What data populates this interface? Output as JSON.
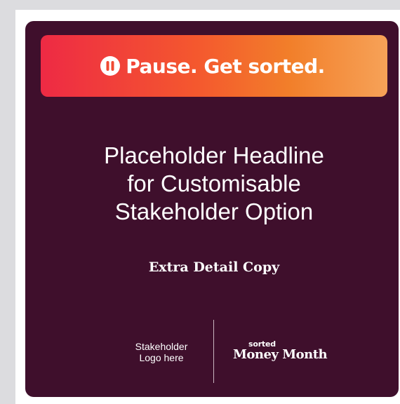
{
  "banner": {
    "text": "Pause. Get sorted.",
    "icon": "pause-icon"
  },
  "headline": {
    "lines": [
      "Placeholder Headline",
      "for Customisable",
      "Stakeholder Option"
    ]
  },
  "detail": "Extra Detail Copy",
  "footer": {
    "stakeholder_logo": {
      "line1": "Stakeholder",
      "line2": "Logo here"
    },
    "brand_logo": {
      "small": "sorted",
      "big": "Money Month"
    }
  },
  "colors": {
    "card_background": "#3f0f2c",
    "banner_gradient_start": "#ee2a44",
    "banner_gradient_end": "#f6a258",
    "text": "#ffffff"
  }
}
